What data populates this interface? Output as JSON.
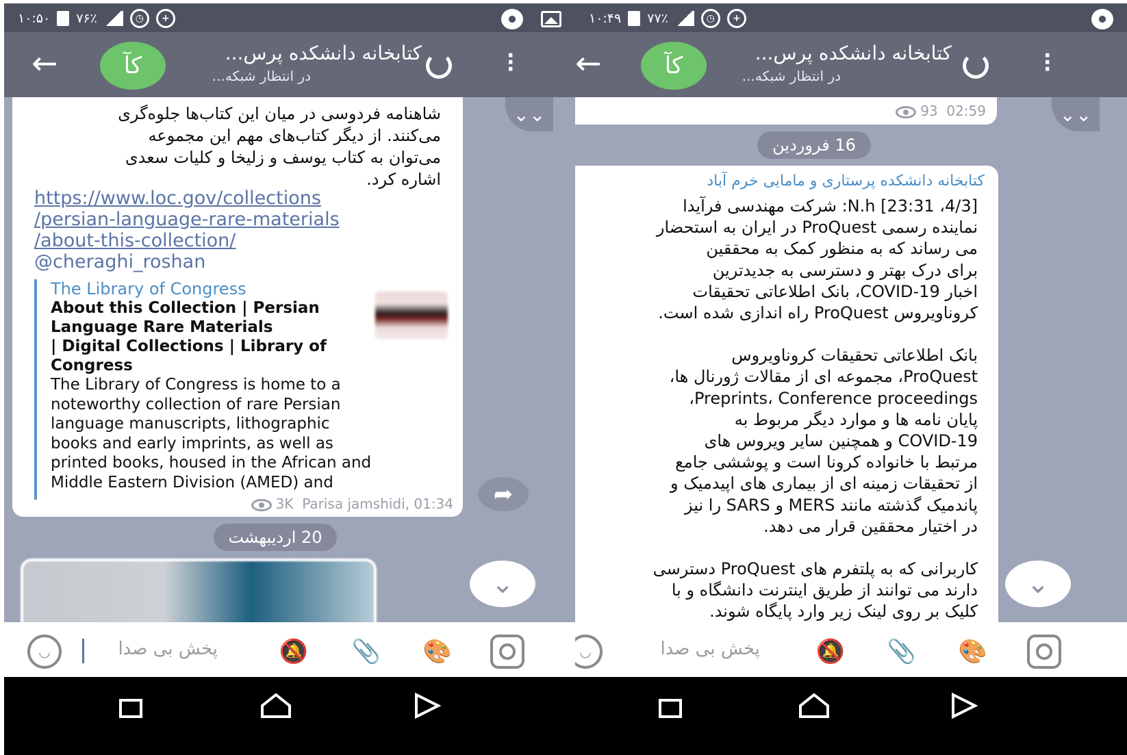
{
  "left": {
    "status": {
      "time": "۱۰:۵۰",
      "battery": "۷۶٪"
    },
    "header": {
      "back_icon": "←",
      "avatar": "کآ",
      "title": "کتابخانه دانشکده پرس...",
      "subtitle": "در انتظار شبکه..."
    },
    "message": {
      "lines": [
        "شاهنامه فردوسی در میان این کتاب‌ها جلوه‌گری",
        "می‌کنند. از دیگر کتاب‌های مهم این مجموعه",
        "می‌توان به کتاب یوسف و زلیخا و کلیات سعدی",
        "اشاره کرد."
      ],
      "link_lines": [
        "https://www.loc.gov/collections",
        "/persian-language-rare-materials",
        "/about-this-collection/"
      ],
      "mention": "@cheraghi_roshan",
      "preview": {
        "site": "The Library of Congress",
        "title_lines": [
          "About this Collection  | Persian",
          "Language Rare Materials",
          "| Digital Collections  | Library of",
          "Congress"
        ],
        "desc_lines": [
          "The Library of Congress is home to a",
          "noteworthy collection of rare Persian",
          "language manuscripts, lithographic",
          "books and early imprints, as well as",
          "printed books, housed in the African and",
          "Middle Eastern Division (AMED) and"
        ]
      },
      "views": "3K",
      "author_time": "Parisa jamshidi, 01:34"
    },
    "date_pill": "20 اردیبهشت",
    "composer_placeholder": "پخش بی صدا"
  },
  "right": {
    "status": {
      "time": "۱۰:۴۹",
      "battery": "۷۷٪"
    },
    "header": {
      "back_icon": "←",
      "avatar": "کآ",
      "title": "کتابخانه دانشکده پرس...",
      "subtitle": "در انتظار شبکه..."
    },
    "prev_views": "93",
    "prev_time": "02:59",
    "date_pill": "16 فروردین",
    "message": {
      "sender": "کتابخانه دانشکده پرستاری و مامایی خرم آباد",
      "lines": [
        "[4/3، 23:31] N.h: شرکت مهندسی فرآیدا",
        "نماینده رسمی ProQuest در ایران به استحضار",
        "می رساند که به منظور کمک به محققین",
        "برای درک بهتر و دسترسی به جدیدترین",
        "اخبار COVID-19، بانک اطلاعاتی تحقیقات",
        "کروناویروس ProQuest راه اندازی شده است.",
        "",
        "بانک اطلاعاتی تحقیقات کروناویروس",
        "ProQuest، مجموعه ای از مقالات ژورنال ها،",
        "Preprints، Conference proceedings،",
        "پایان نامه ها و موارد دیگر مربوط به",
        "COVID-19 و همچنین سایر ویروس های",
        "مرتبط با خانواده کرونا است و پوششی جامع",
        "از تحقیقات زمینه ای از بیماری های اپیدمیک و",
        "پاندمیک گذشته مانند MERS و SARS را نیز",
        "در اختیار محققین قرار می دهد.",
        "",
        "کاربرانی که به پلتفرم های ProQuest دسترسی",
        "دارند می توانند از طریق اینترنت دانشگاه و با",
        "کلیک بر روی لینک زیر وارد پایگاه شوند."
      ]
    },
    "composer_placeholder": "پخش بی صدا"
  },
  "icons": {
    "scroll_down": "⌄",
    "double_chevron": "⌄⌄",
    "forward": "➦"
  }
}
